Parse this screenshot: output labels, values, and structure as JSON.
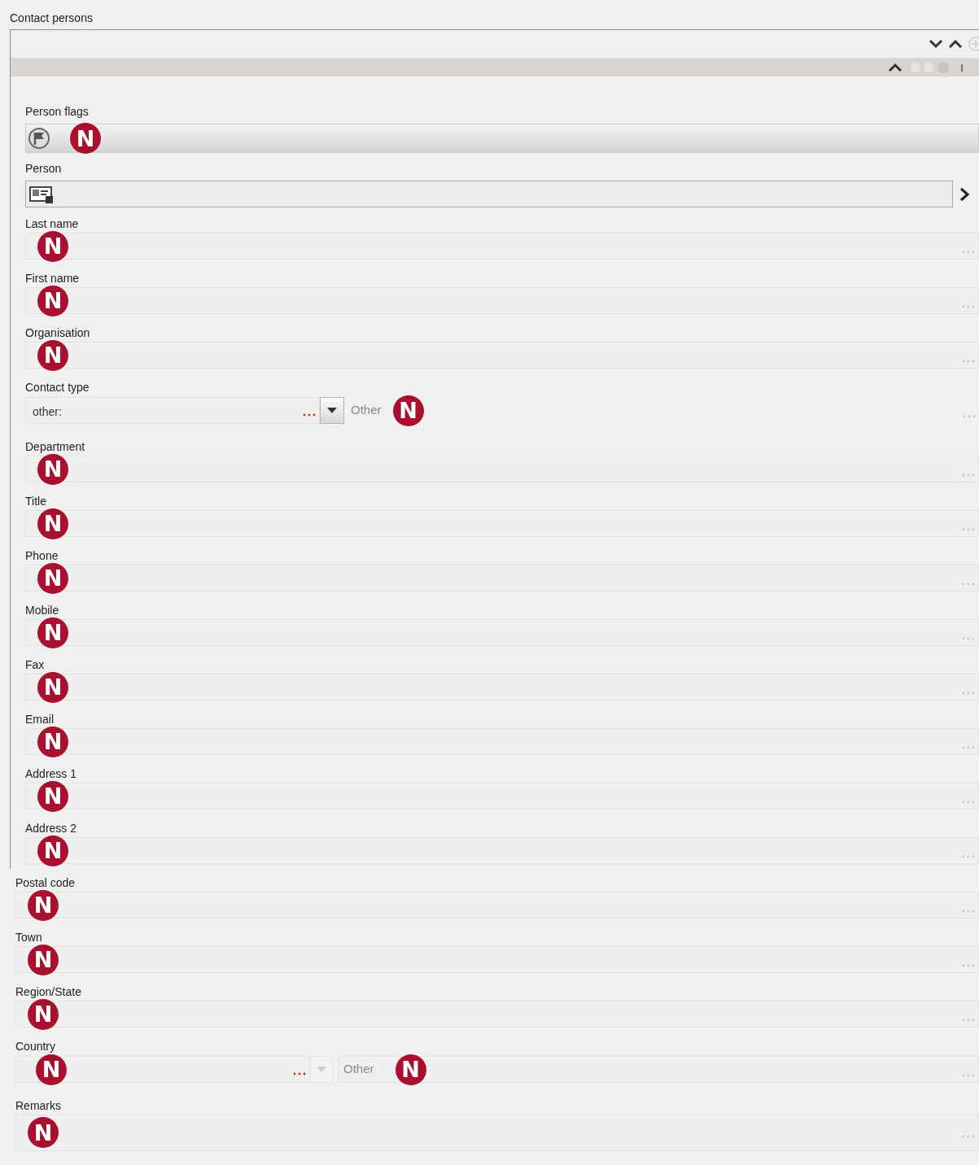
{
  "section_title": "Contact persons",
  "panel_fields": [
    {
      "kind": "flags",
      "label": "Person flags",
      "badge": "N"
    },
    {
      "kind": "person",
      "label": "Person"
    },
    {
      "kind": "text",
      "label": "Last name",
      "badge": "N"
    },
    {
      "kind": "text",
      "label": "First name",
      "badge": "N"
    },
    {
      "kind": "text",
      "label": "Organisation",
      "badge": "N"
    },
    {
      "kind": "combo",
      "label": "Contact type",
      "value": "other:",
      "disabled": false,
      "other_label": "Other",
      "badge": "N"
    },
    {
      "kind": "text",
      "label": "Department",
      "badge": "N"
    },
    {
      "kind": "text",
      "label": "Title",
      "badge": "N"
    },
    {
      "kind": "text",
      "label": "Phone",
      "badge": "N"
    },
    {
      "kind": "text",
      "label": "Mobile",
      "badge": "N"
    },
    {
      "kind": "text",
      "label": "Fax",
      "badge": "N"
    },
    {
      "kind": "text",
      "label": "Email",
      "badge": "N"
    },
    {
      "kind": "text",
      "label": "Address 1",
      "badge": "N"
    },
    {
      "kind": "text",
      "label": "Address 2",
      "badge": "N"
    }
  ],
  "outer_fields": [
    {
      "kind": "text",
      "label": "Postal code",
      "badge": "N"
    },
    {
      "kind": "text",
      "label": "Town",
      "badge": "N"
    },
    {
      "kind": "text",
      "label": "Region/State",
      "badge": "N"
    },
    {
      "kind": "combo",
      "label": "Country",
      "disabled": true,
      "badge": "N",
      "other_label": "Other",
      "other_badge": "N"
    },
    {
      "kind": "multiline",
      "label": "Remarks",
      "badge": "N"
    }
  ]
}
